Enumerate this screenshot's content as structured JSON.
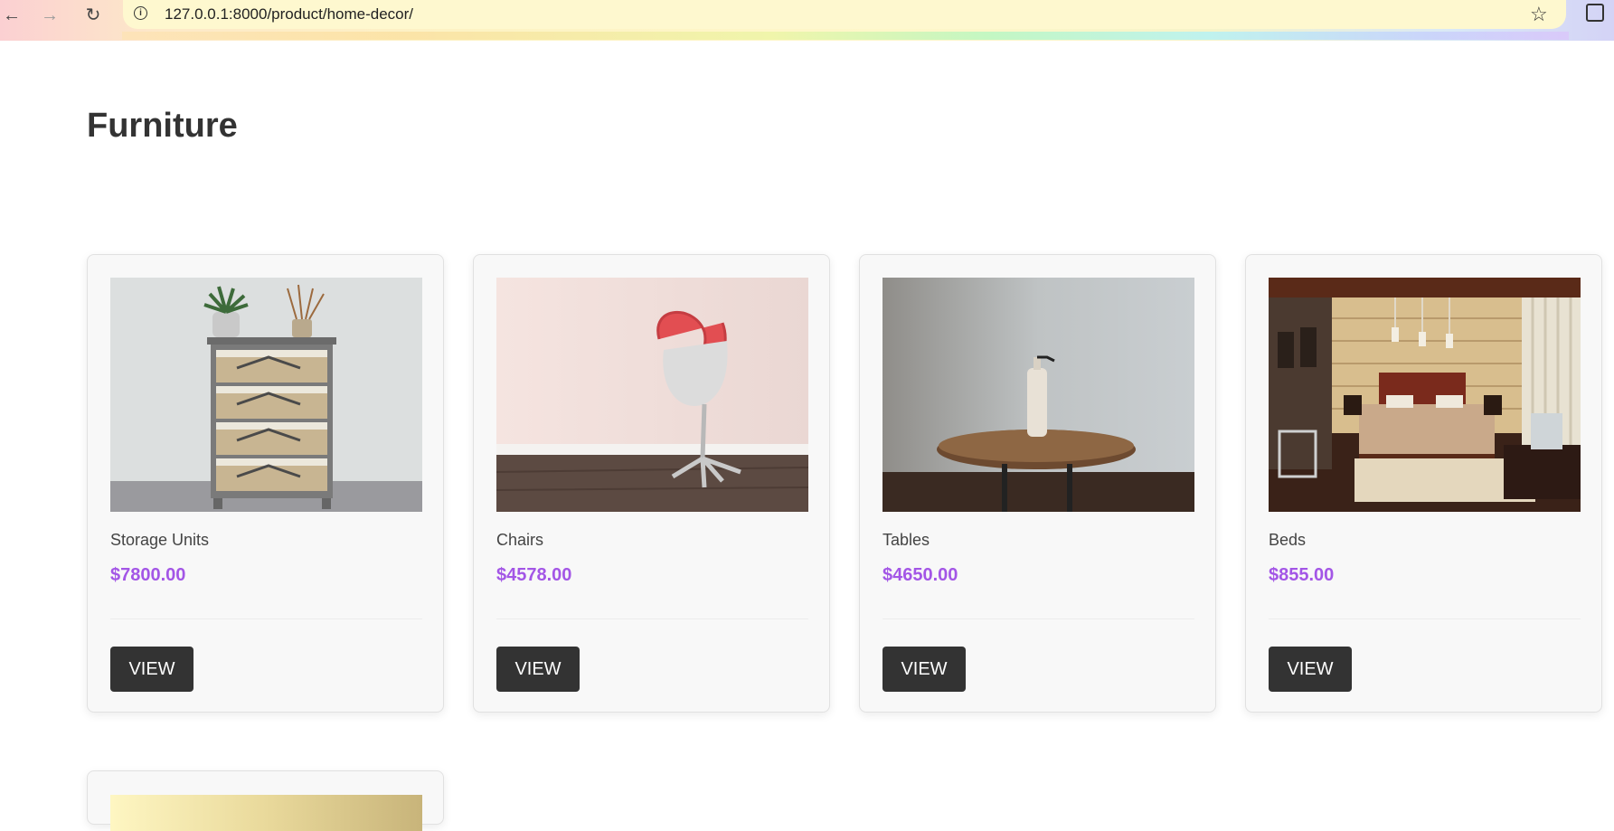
{
  "browser": {
    "url": "127.0.0.1:8000/product/home-decor/"
  },
  "page": {
    "title": "Furniture"
  },
  "products": [
    {
      "name": "Storage Units",
      "price": "$7800.00",
      "button": "VIEW"
    },
    {
      "name": "Chairs",
      "price": "$4578.00",
      "button": "VIEW"
    },
    {
      "name": "Tables",
      "price": "$4650.00",
      "button": "VIEW"
    },
    {
      "name": "Beds",
      "price": "$855.00",
      "button": "VIEW"
    }
  ],
  "colors": {
    "price": "#a356e6",
    "button_bg": "#333333",
    "title": "#333333"
  },
  "icons": [
    "back-arrow-icon",
    "forward-arrow-icon",
    "reload-icon",
    "info-icon",
    "star-icon",
    "extensions-icon"
  ]
}
